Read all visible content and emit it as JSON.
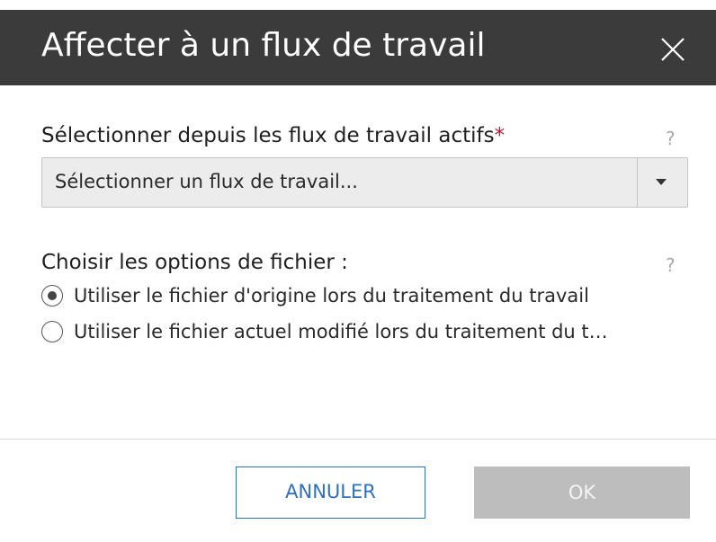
{
  "dialog": {
    "title": "Affecter à un flux de travail",
    "close_icon": "close-icon"
  },
  "workflow_section": {
    "label": "Sélectionner depuis les flux de travail actifs",
    "required_marker": "*",
    "help": "?",
    "select_value": "Sélectionner un flux de travail...",
    "caret_icon": "caret-down-icon"
  },
  "file_options": {
    "label": "Choisir les options de fichier :",
    "help": "?",
    "options": [
      {
        "label": "Utiliser le fichier d'origine lors du traitement du travail",
        "selected": true
      },
      {
        "label": "Utiliser le fichier actuel modifié lors du traitement du t…",
        "selected": false
      }
    ]
  },
  "footer": {
    "cancel_label": "ANNULER",
    "ok_label": "OK"
  },
  "colors": {
    "titlebar": "#3b3b3b",
    "accent": "#2f6fbf",
    "required": "#c8102e",
    "disabled_button": "#bdbdbd"
  }
}
